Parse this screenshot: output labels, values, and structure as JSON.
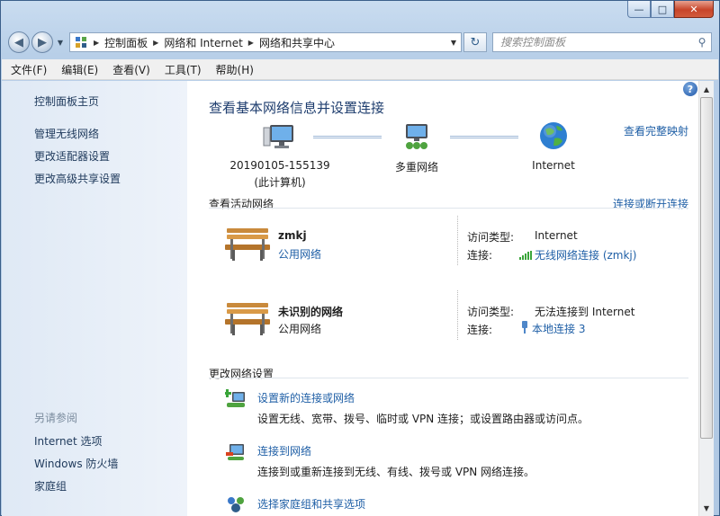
{
  "window": {
    "controls": {
      "minimize": "—",
      "maximize": "□",
      "close": "✕"
    }
  },
  "address": {
    "crumbs": [
      "控制面板",
      "网络和 Internet",
      "网络和共享中心"
    ],
    "search_placeholder": "搜索控制面板"
  },
  "menu": [
    "文件(F)",
    "编辑(E)",
    "查看(V)",
    "工具(T)",
    "帮助(H)"
  ],
  "left_pane": {
    "home": "控制面板主页",
    "links": [
      "管理无线网络",
      "更改适配器设置",
      "更改高级共享设置"
    ],
    "see_also_header": "另请参阅",
    "see_also": [
      "Internet 选项",
      "Windows 防火墙",
      "家庭组"
    ]
  },
  "main": {
    "title": "查看基本网络信息并设置连接",
    "full_map": "查看完整映射",
    "map": {
      "computer_name": "20190105-155139",
      "computer_sub": "(此计算机)",
      "multi": "多重网络",
      "internet": "Internet"
    },
    "active_header": "查看活动网络",
    "connect_disconnect": "连接或断开连接",
    "networks": [
      {
        "name": "zmkj",
        "type": "公用网络",
        "type_is_link": true,
        "access_label": "访问类型:",
        "access_value": "Internet",
        "conn_label": "连接:",
        "conn_value": "无线网络连接 (zmkj)",
        "conn_icon": "wifi-signal-icon"
      },
      {
        "name": "未识别的网络",
        "type": "公用网络",
        "type_is_link": false,
        "access_label": "访问类型:",
        "access_value": "无法连接到 Internet",
        "conn_label": "连接:",
        "conn_value": "本地连接 3",
        "conn_icon": "ethernet-icon"
      }
    ],
    "change_header": "更改网络设置",
    "tasks": [
      {
        "link": "设置新的连接或网络",
        "desc": "设置无线、宽带、拨号、临时或 VPN 连接；或设置路由器或访问点。"
      },
      {
        "link": "连接到网络",
        "desc": "连接到或重新连接到无线、有线、拨号或 VPN 网络连接。"
      },
      {
        "link": "选择家庭组和共享选项",
        "desc": ""
      }
    ]
  }
}
